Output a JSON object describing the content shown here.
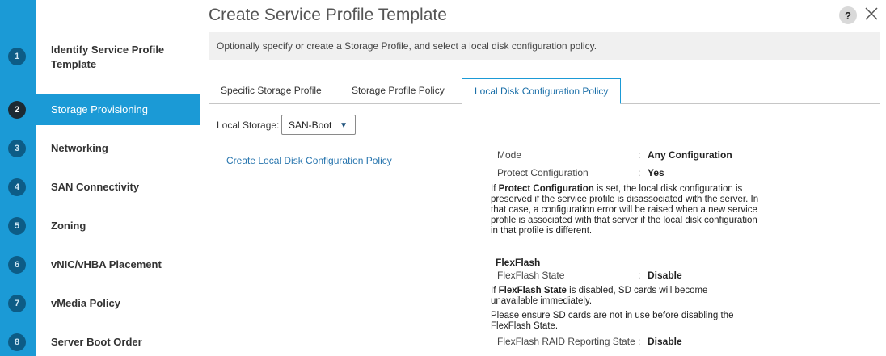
{
  "header": {
    "title": "Create Service Profile Template",
    "help_label": "?",
    "description": "Optionally specify or create a Storage Profile, and select a local disk configuration policy."
  },
  "steps": [
    {
      "num": "1",
      "label": "Identify Service Profile Template",
      "active": false
    },
    {
      "num": "2",
      "label": "Storage Provisioning",
      "active": true
    },
    {
      "num": "3",
      "label": "Networking",
      "active": false
    },
    {
      "num": "4",
      "label": "SAN Connectivity",
      "active": false
    },
    {
      "num": "5",
      "label": "Zoning",
      "active": false
    },
    {
      "num": "6",
      "label": "vNIC/vHBA Placement",
      "active": false
    },
    {
      "num": "7",
      "label": "vMedia Policy",
      "active": false
    },
    {
      "num": "8",
      "label": "Server Boot Order",
      "active": false
    }
  ],
  "tabs": [
    {
      "label": "Specific Storage Profile",
      "active": false
    },
    {
      "label": "Storage Profile Policy",
      "active": false
    },
    {
      "label": "Local Disk Configuration Policy",
      "active": true
    }
  ],
  "local_storage": {
    "label": "Local Storage:",
    "selected": "SAN-Boot"
  },
  "create_link": "Create Local Disk Configuration Policy",
  "details": {
    "mode_label": "Mode",
    "mode_value": "Any Configuration",
    "protect_label": "Protect Configuration",
    "protect_value": "Yes",
    "protect_note_prefix": "If ",
    "protect_note_bold": "Protect Configuration",
    "protect_note_rest": " is set, the local disk configuration is preserved if the service profile is disassociated with the server. In that case, a configuration error will be raised when a new service profile is associated with that server if the local disk configuration in that profile is different.",
    "flexflash_heading": "FlexFlash",
    "flexflash_state_label": "FlexFlash State",
    "flexflash_state_value": "Disable",
    "flexflash_note_prefix": "If ",
    "flexflash_note_bold": "FlexFlash State",
    "flexflash_note_rest": " is disabled, SD cards will become unavailable immediately.",
    "flexflash_note2": "Please ensure SD cards are not in use before disabling the FlexFlash State.",
    "raid_label": "FlexFlash RAID Reporting State",
    "raid_value": "Disable",
    "colon": ":"
  },
  "colors": {
    "accent": "#1b9ad6",
    "step_badge": "#0d5c86",
    "link": "#2775ae"
  }
}
